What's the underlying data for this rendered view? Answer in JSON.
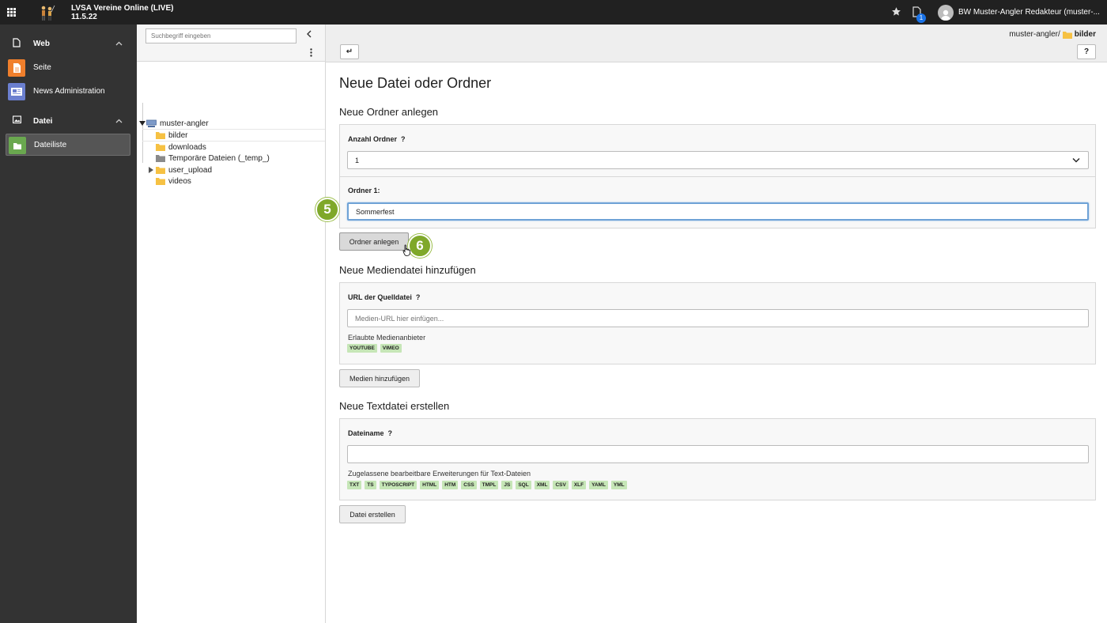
{
  "topbar": {
    "site_name": "LVSA Vereine Online (LIVE)",
    "version": "11.5.22",
    "notification_count": "1",
    "user_name": "BW Muster-Angler Redakteur (muster-..."
  },
  "modules": {
    "web_group": "Web",
    "web_items": [
      "Seite",
      "News Administration"
    ],
    "datei_group": "Datei",
    "datei_items": [
      "Dateiliste"
    ]
  },
  "tree": {
    "search_placeholder": "Suchbegriff eingeben",
    "root": "muster-angler",
    "folders": [
      "bilder",
      "downloads",
      "Temporäre Dateien (_temp_)",
      "user_upload",
      "videos"
    ]
  },
  "header": {
    "path_prefix": "muster-angler/",
    "path_current": "bilder",
    "back_label": "↵",
    "help_label": "?"
  },
  "page": {
    "title": "Neue Datei oder Ordner",
    "folder_section": {
      "heading": "Neue Ordner anlegen",
      "count_label": "Anzahl Ordner",
      "count_help": "?",
      "count_value": "1",
      "folder_label": "Ordner 1:",
      "folder_value": "Sommerfest",
      "button": "Ordner anlegen"
    },
    "media_section": {
      "heading": "Neue Mediendatei hinzufügen",
      "url_label": "URL der Quelldatei",
      "url_help": "?",
      "url_placeholder": "Medien-URL hier einfügen...",
      "providers_label": "Erlaubte Medienanbieter",
      "providers": [
        "YOUTUBE",
        "VIMEO"
      ],
      "button": "Medien hinzufügen"
    },
    "text_section": {
      "heading": "Neue Textdatei erstellen",
      "name_label": "Dateiname",
      "name_help": "?",
      "name_value": "",
      "ext_label": "Zugelassene bearbeitbare Erweiterungen für Text-Dateien",
      "extensions": [
        "TXT",
        "TS",
        "TYPOSCRIPT",
        "HTML",
        "HTM",
        "CSS",
        "TMPL",
        "JS",
        "SQL",
        "XML",
        "CSV",
        "XLF",
        "YAML",
        "YML"
      ],
      "button": "Datei erstellen"
    }
  },
  "steps": [
    "5",
    "6"
  ],
  "colors": {
    "topbar": "#212121",
    "module_menu": "#333333",
    "step_badge": "#7fa82a",
    "tag": "#c6e6b7",
    "seite_icon": "#f07f2c",
    "news_icon": "#6b7fcf",
    "datei_icon": "#6aa84f",
    "folder": "#f6c143"
  }
}
